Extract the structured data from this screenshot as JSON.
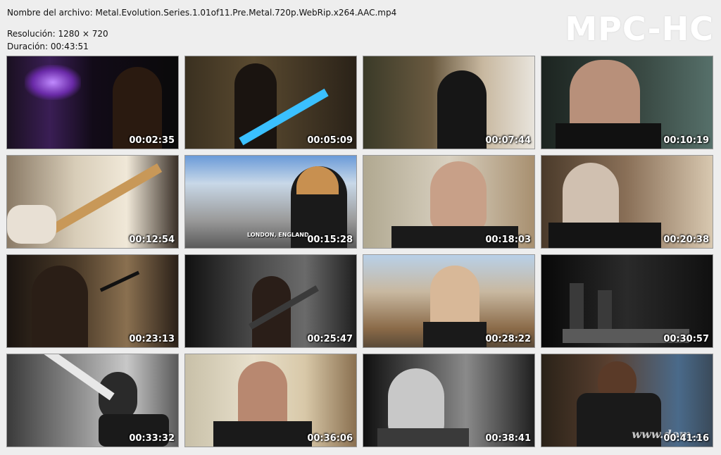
{
  "file": {
    "name_label": "Nombre del archivo:",
    "name": "Metal.Evolution.Series.1.01of11.Pre.Metal.720p.WebRip.x264.AAC.mp4",
    "resolution_label": "Resolución:",
    "resolution": "1280 × 720",
    "duration_label": "Duración:",
    "duration": "00:43:51"
  },
  "logo": "MPC-HC",
  "watermark": "www.dom...",
  "thumbnails": [
    {
      "time": "00:02:35"
    },
    {
      "time": "00:05:09"
    },
    {
      "time": "00:07:44"
    },
    {
      "time": "00:10:19"
    },
    {
      "time": "00:12:54"
    },
    {
      "time": "00:15:28",
      "subtitle": "LONDON, ENGLAND"
    },
    {
      "time": "00:18:03"
    },
    {
      "time": "00:20:38"
    },
    {
      "time": "00:23:13"
    },
    {
      "time": "00:25:47"
    },
    {
      "time": "00:28:22"
    },
    {
      "time": "00:30:57"
    },
    {
      "time": "00:33:32"
    },
    {
      "time": "00:36:06"
    },
    {
      "time": "00:38:41"
    },
    {
      "time": "00:41:16"
    }
  ]
}
